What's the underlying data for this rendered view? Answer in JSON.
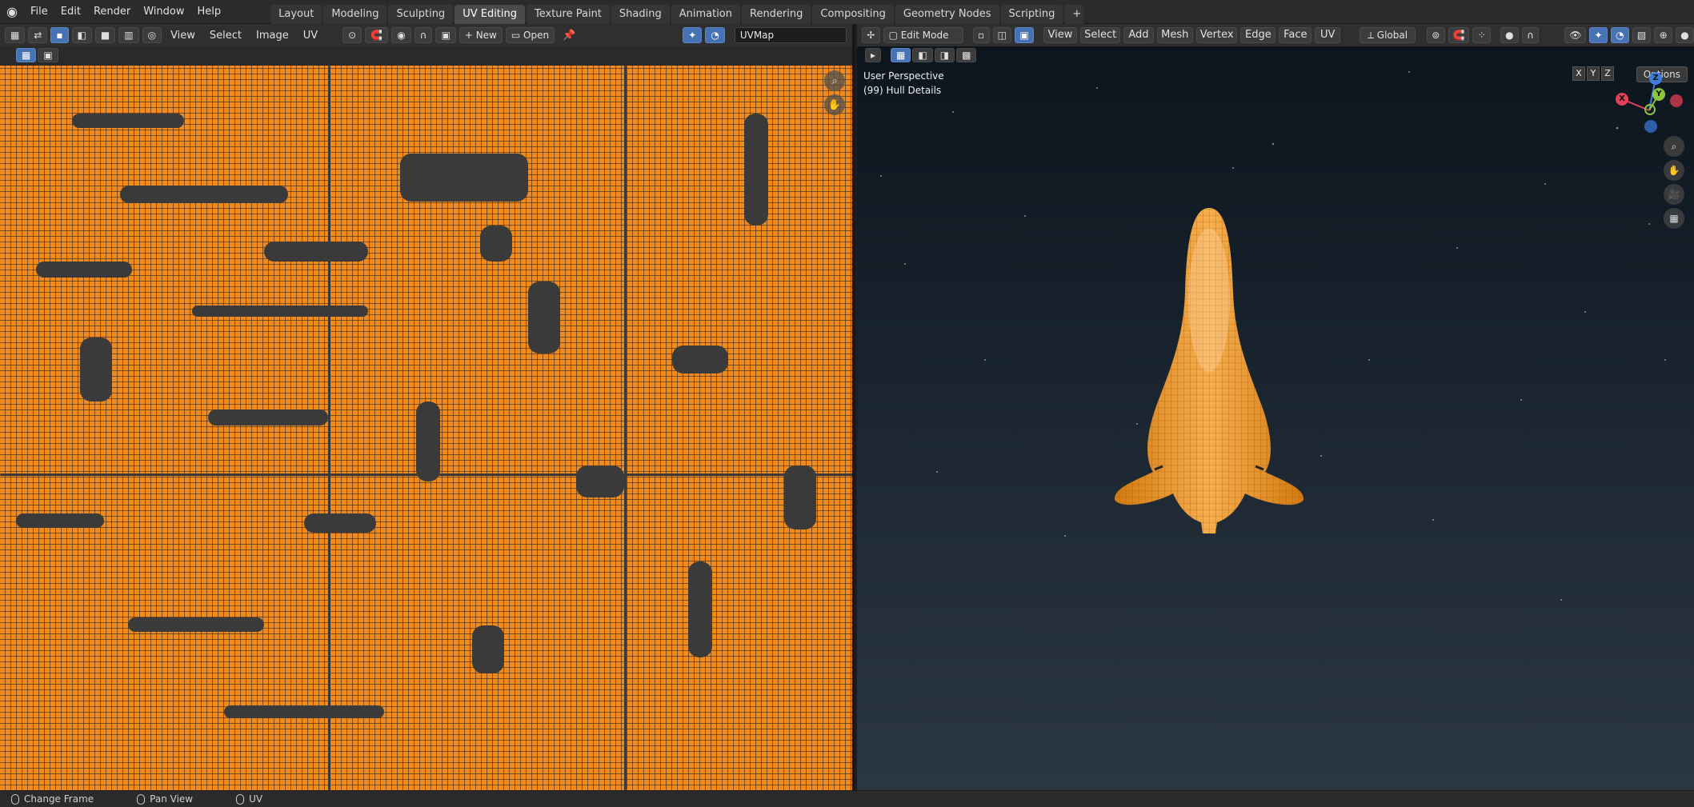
{
  "menubar": {
    "items": [
      "File",
      "Edit",
      "Render",
      "Window",
      "Help"
    ]
  },
  "workspaces": {
    "tabs": [
      "Layout",
      "Modeling",
      "Sculpting",
      "UV Editing",
      "Texture Paint",
      "Shading",
      "Animation",
      "Rendering",
      "Compositing",
      "Geometry Nodes",
      "Scripting"
    ],
    "active": "UV Editing",
    "add_label": "+"
  },
  "uv_editor": {
    "menus": [
      "View",
      "Select",
      "Image",
      "UV"
    ],
    "new_label": "New",
    "open_label": "Open",
    "uvmap_name": "UVMap"
  },
  "viewport": {
    "mode": "Edit Mode",
    "menus": [
      "View",
      "Select",
      "Add",
      "Mesh",
      "Vertex",
      "Edge",
      "Face",
      "UV"
    ],
    "orientation": "Global",
    "perspective_label": "User Perspective",
    "object_label": "(99) Hull Details",
    "axis_toggles": [
      "X",
      "Y",
      "Z"
    ],
    "options_label": "Options",
    "gizmo": {
      "x": "X",
      "y": "Y",
      "z": "Z"
    }
  },
  "statusbar": {
    "items": [
      "Change Frame",
      "Pan View",
      "UV"
    ]
  },
  "colors": {
    "accent": "#4772b3",
    "uv_orange": "#f08a1c",
    "axis_x": "#e2405a",
    "axis_y": "#8bc53f",
    "axis_z": "#3d7ddb"
  }
}
